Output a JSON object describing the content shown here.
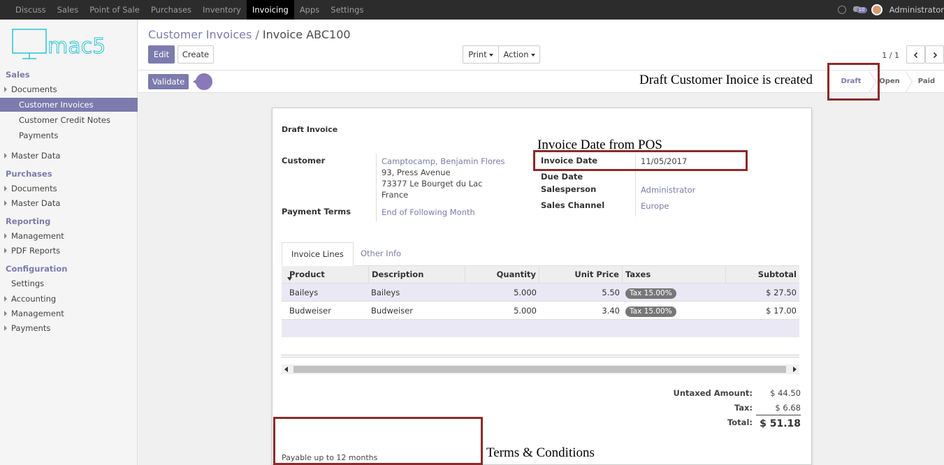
{
  "topbar": {
    "menu": [
      "Discuss",
      "Sales",
      "Point of Sale",
      "Purchases",
      "Inventory",
      "Invoicing",
      "Apps",
      "Settings"
    ],
    "active": "Invoicing",
    "messages_count": "10",
    "user": "Administrator"
  },
  "logo": {
    "text": "mac5"
  },
  "sidebar": {
    "sales": "Sales",
    "sales_items": [
      "Documents",
      "Customer Invoices",
      "Customer Credit Notes",
      "Payments",
      "Master Data"
    ],
    "purchases": "Purchases",
    "purchases_items": [
      "Documents",
      "Master Data"
    ],
    "reporting": "Reporting",
    "reporting_items": [
      "Management",
      "PDF Reports"
    ],
    "configuration": "Configuration",
    "configuration_items": [
      "Settings",
      "Accounting",
      "Management",
      "Payments"
    ]
  },
  "breadcrumb": {
    "parent": "Customer Invoices",
    "separator": "/",
    "current": "Invoice ABC100"
  },
  "buttons": {
    "edit": "Edit",
    "create": "Create",
    "print": "Print",
    "action": "Action",
    "validate": "Validate"
  },
  "pager": {
    "text": "1 / 1"
  },
  "status": {
    "stages": [
      "Draft",
      "Open",
      "Paid"
    ],
    "current": "Draft"
  },
  "form": {
    "title": "Draft Invoice",
    "customer_label": "Customer",
    "customer_name": "Camptocamp, Benjamin Flores",
    "address1": "93, Press Avenue",
    "address2": "73377 Le Bourget du Lac",
    "address3": "France",
    "payment_terms_label": "Payment Terms",
    "payment_terms": "End of Following Month",
    "invoice_date_label": "Invoice Date",
    "invoice_date": "11/05/2017",
    "due_date_label": "Due Date",
    "salesperson_label": "Salesperson",
    "salesperson": "Administrator",
    "channel_label": "Sales Channel",
    "channel": "Europe"
  },
  "tabs": [
    "Invoice Lines",
    "Other Info"
  ],
  "table": {
    "headers": [
      "Product",
      "Description",
      "Quantity",
      "Unit Price",
      "Taxes",
      "Subtotal"
    ],
    "rows": [
      {
        "product": "Baileys",
        "description": "Baileys",
        "quantity": "5.000",
        "unit_price": "5.50",
        "tax": "Tax 15.00%",
        "subtotal": "$ 27.50"
      },
      {
        "product": "Budweiser",
        "description": "Budweiser",
        "quantity": "5.000",
        "unit_price": "3.40",
        "tax": "Tax 15.00%",
        "subtotal": "$ 17.00"
      }
    ]
  },
  "totals": {
    "untaxed_label": "Untaxed Amount:",
    "untaxed": "$ 44.50",
    "tax_label": "Tax:",
    "tax": "$ 6.68",
    "total_label": "Total:",
    "total": "$ 51.18"
  },
  "terms": "Payable up to 12 months",
  "annotations": {
    "draft": "Draft Customer Inoice is created",
    "invoice_date": "Invoice Date from POS",
    "terms": "Terms & Conditions"
  },
  "colors": {
    "accent": "#7c7bad",
    "topbar": "#2c2c2c",
    "annotation_box": "#8b2b2b"
  }
}
